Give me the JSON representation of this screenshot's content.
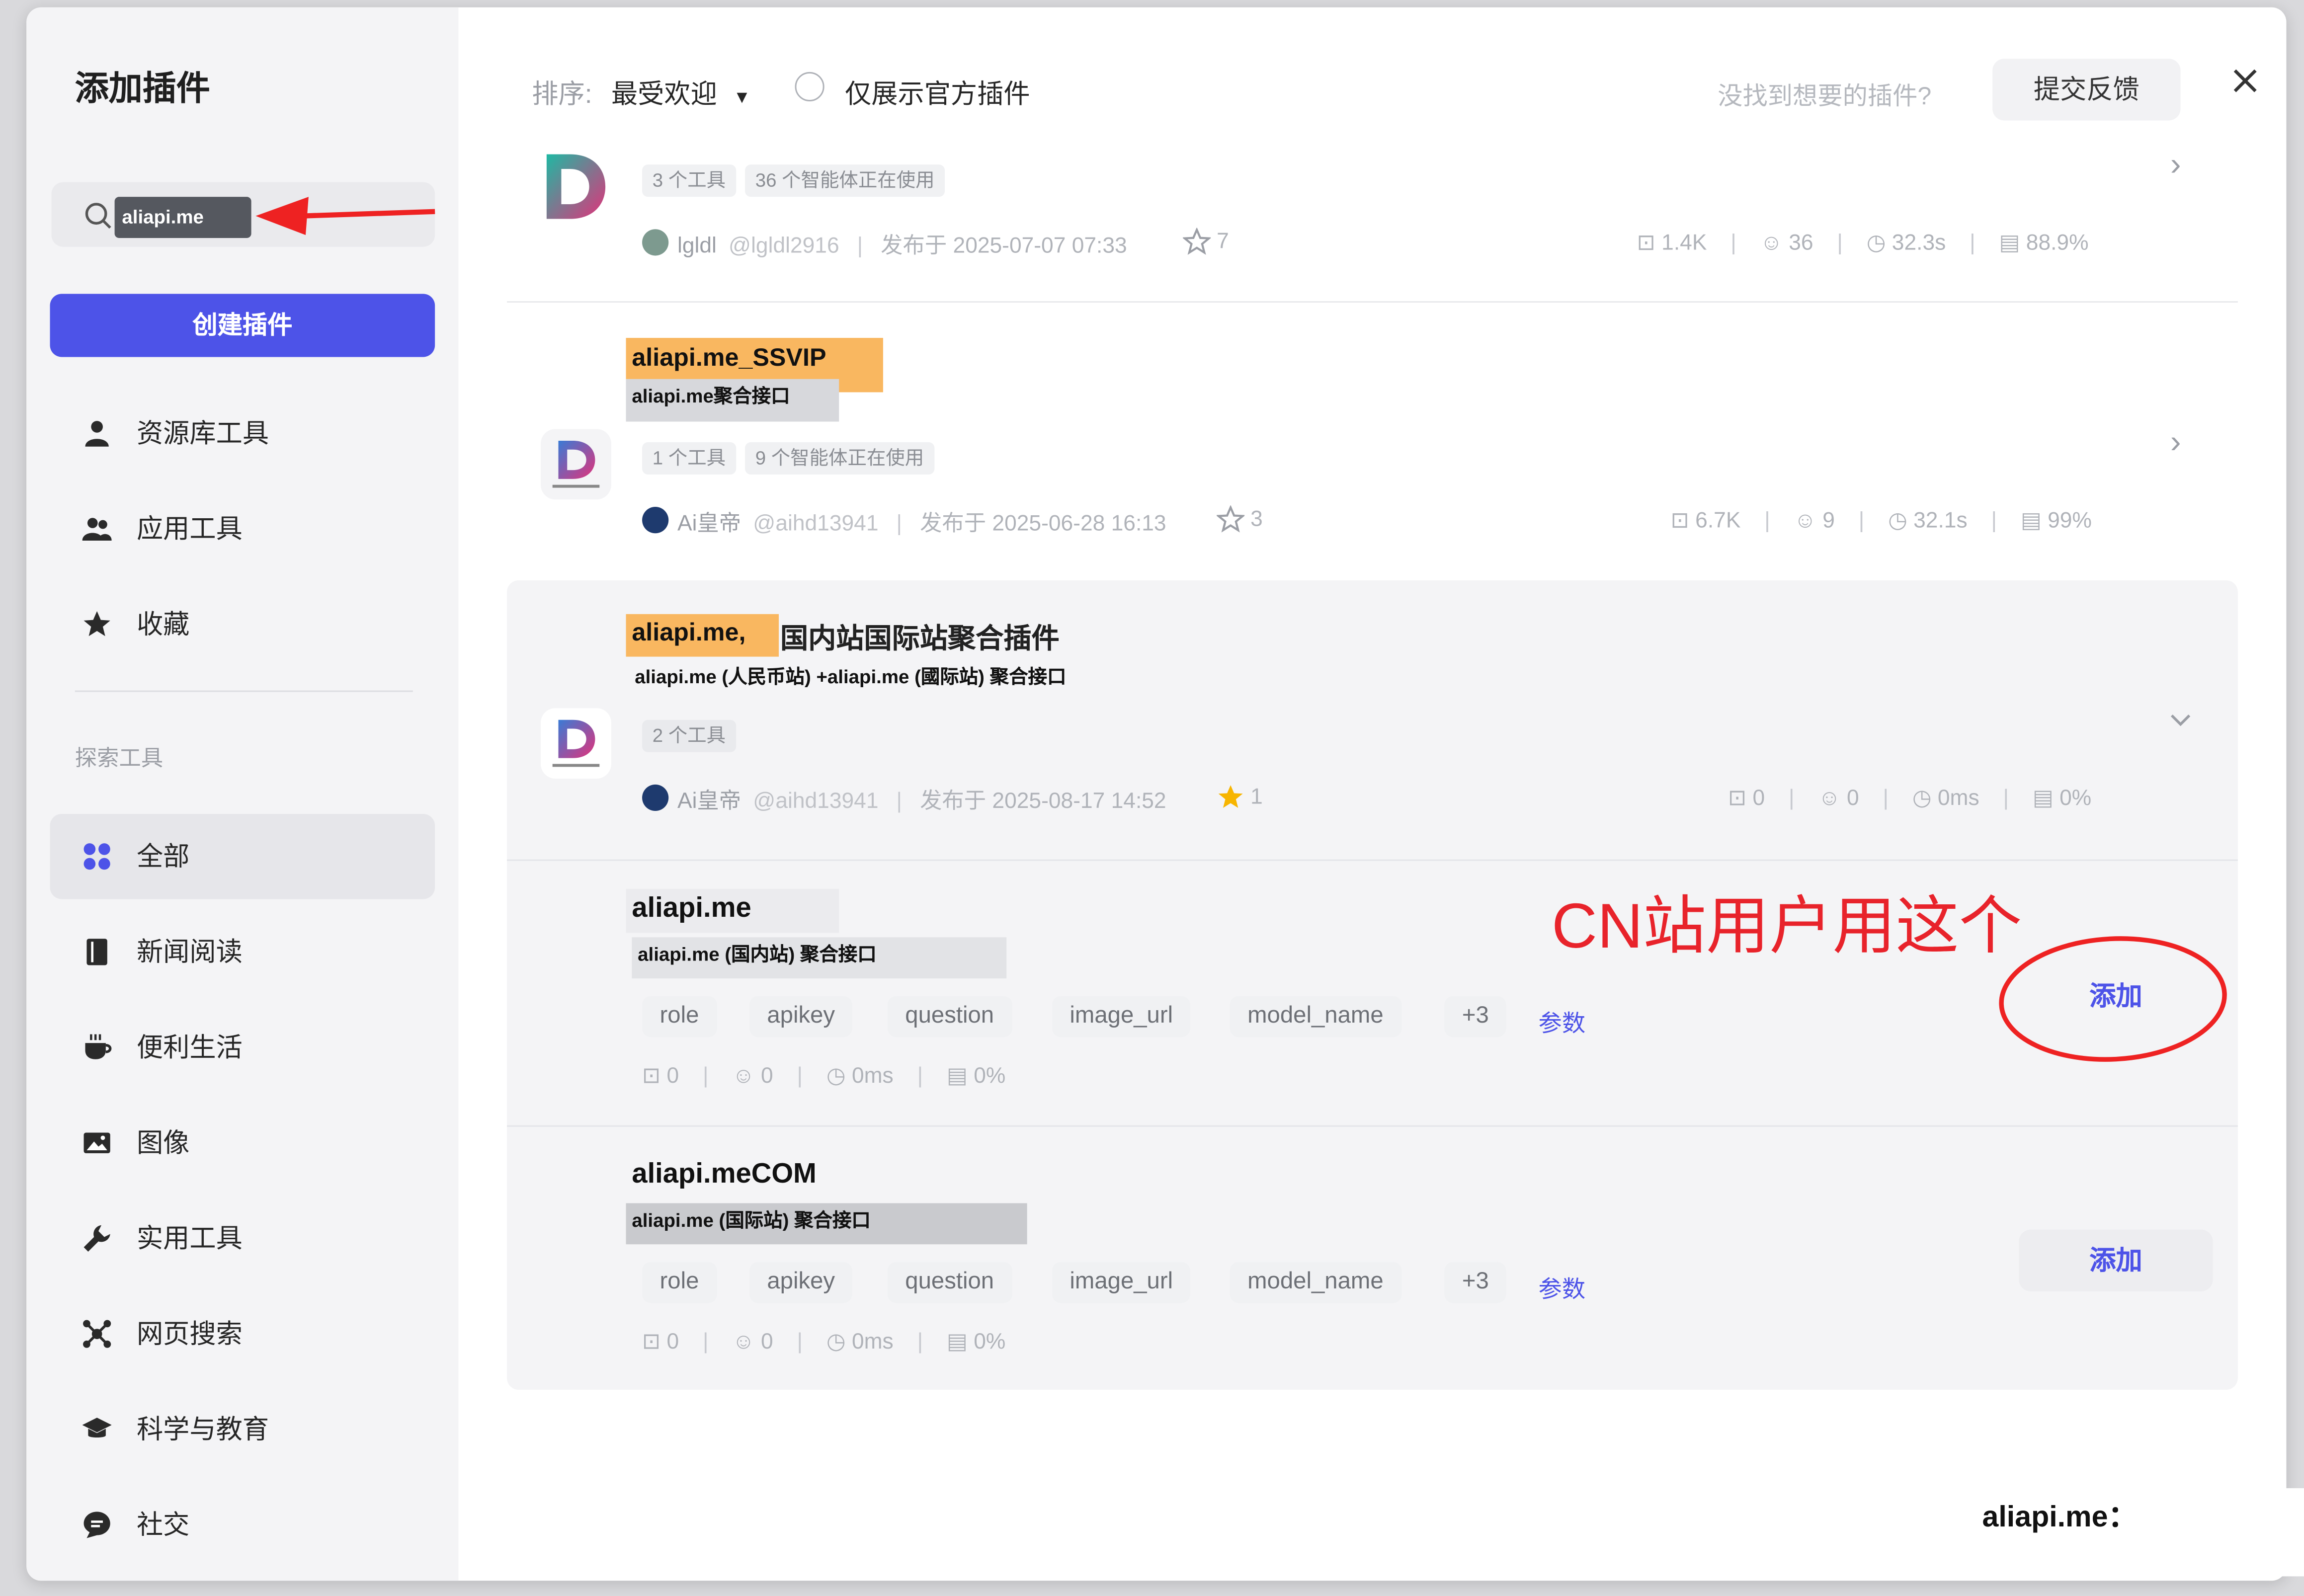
{
  "sidebar": {
    "title": "添加插件",
    "search": {
      "value": "aliapi.me"
    },
    "create_button": "创建插件",
    "nav_top": [
      {
        "label": "资源库工具",
        "icon": "person-icon"
      },
      {
        "label": "应用工具",
        "icon": "people-icon"
      },
      {
        "label": "收藏",
        "icon": "star-icon"
      }
    ],
    "section_label": "探索工具",
    "nav_explore": [
      {
        "label": "全部",
        "icon": "grid-icon",
        "active": true
      },
      {
        "label": "新闻阅读",
        "icon": "book-icon"
      },
      {
        "label": "便利生活",
        "icon": "cup-icon"
      },
      {
        "label": "图像",
        "icon": "image-icon"
      },
      {
        "label": "实用工具",
        "icon": "wrench-icon"
      },
      {
        "label": "网页搜索",
        "icon": "network-icon"
      },
      {
        "label": "科学与教育",
        "icon": "graduation-cap-icon"
      },
      {
        "label": "社交",
        "icon": "chat-icon"
      }
    ]
  },
  "toolbar": {
    "sort_label": "排序:",
    "sort_value": "最受欢迎",
    "official_only": "仅展示官方插件",
    "not_found": "没找到想要的插件?",
    "feedback_button": "提交反馈"
  },
  "plugins": [
    {
      "tags": [
        "3 个工具",
        "36 个智能体正在使用"
      ],
      "author": "lgldl",
      "handle": "@lgldl2916",
      "published": "发布于 2025-07-07 07:33",
      "stars": "7",
      "stats": [
        "1.4K",
        "36",
        "32.3s",
        "88.9%"
      ]
    },
    {
      "title": "aliapi.me_SSVIP",
      "desc": "aliapi.me聚合接口",
      "tags": [
        "1 个工具",
        "9 个智能体正在使用"
      ],
      "author": "Ai皇帝",
      "handle": "@aihd13941",
      "published": "发布于 2025-06-28 16:13",
      "stars": "3",
      "stats": [
        "6.7K",
        "9",
        "32.1s",
        "99%"
      ]
    },
    {
      "title_hl": "aliapi.me,",
      "title_rest": "国内站国际站聚合插件",
      "desc": "aliapi.me (人民币站) +aliapi.me (國际站) 聚合接口",
      "tags": [
        "2 个工具"
      ],
      "author": "Ai皇帝",
      "handle": "@aihd13941",
      "published": "发布于 2025-08-17 14:52",
      "stars": "1",
      "stats": [
        "0",
        "0",
        "0ms",
        "0%"
      ],
      "tools": [
        {
          "name": "aliapi.me",
          "desc": "aliapi.me (国内站) 聚合接口",
          "params": [
            "role",
            "apikey",
            "question",
            "image_url",
            "model_name",
            "+3"
          ],
          "params_link": "参数",
          "stats": [
            "0",
            "0",
            "0ms",
            "0%"
          ],
          "add": "添加"
        },
        {
          "name": "aliapi.meCOM",
          "desc": "aliapi.me (国际站) 聚合接口",
          "params": [
            "role",
            "apikey",
            "question",
            "image_url",
            "model_name",
            "+3"
          ],
          "params_link": "参数",
          "stats": [
            "0",
            "0",
            "0ms",
            "0%"
          ],
          "add": "添加"
        }
      ]
    }
  ],
  "annotation": "CN站用户用这个",
  "watermark": "aliapi.me："
}
